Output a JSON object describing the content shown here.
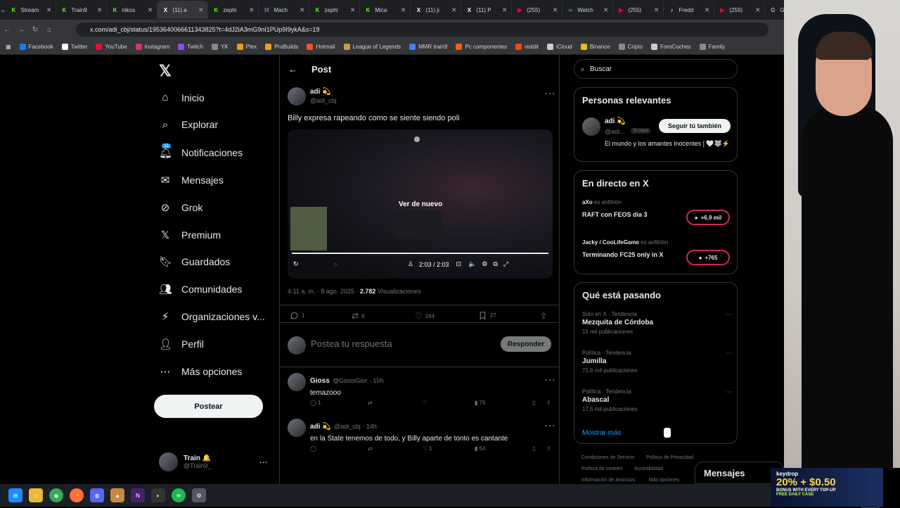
{
  "browser": {
    "tabs": [
      {
        "label": "Stream",
        "fav": "K",
        "color": "#53fc18"
      },
      {
        "label": "Train9",
        "fav": "K",
        "color": "#53fc18"
      },
      {
        "label": "nikos",
        "fav": "K",
        "color": "#53fc18"
      },
      {
        "label": "(11) a",
        "fav": "X",
        "color": "#ffffff",
        "active": true
      },
      {
        "label": "zephi",
        "fav": "K",
        "color": "#53fc18"
      },
      {
        "label": "Mach",
        "fav": "M",
        "color": "#9b59b6"
      },
      {
        "label": "zephi",
        "fav": "K",
        "color": "#53fc18"
      },
      {
        "label": "Mica",
        "fav": "K",
        "color": "#53fc18"
      },
      {
        "label": "(11) ji",
        "fav": "X",
        "color": "#ffffff"
      },
      {
        "label": "(11) P",
        "fav": "X",
        "color": "#ffffff"
      },
      {
        "label": "(255)",
        "fav": "▶",
        "color": "#ff0033"
      },
      {
        "label": "Watch",
        "fav": "∞",
        "color": "#1d9bf0"
      },
      {
        "label": "(255)",
        "fav": "▶",
        "color": "#ff0033"
      },
      {
        "label": "Fredd",
        "fav": "♪",
        "color": "#ffffff"
      },
      {
        "label": "(255)",
        "fav": "▶",
        "color": "#ff0033"
      },
      {
        "label": "Givea",
        "fav": "G",
        "color": "#aaaaaa"
      }
    ],
    "url": "x.com/adi_cbj/status/1953640066611343825?t=4dJ2iA3mG9nI1PUp9I9ykA&s=19",
    "bookmarks": [
      {
        "label": "Facebook",
        "color": "#1877f2"
      },
      {
        "label": "Twitter",
        "color": "#ffffff"
      },
      {
        "label": "YouTube",
        "color": "#ff0033"
      },
      {
        "label": "Instagram",
        "color": "#e1306c"
      },
      {
        "label": "Twitch",
        "color": "#9146ff"
      },
      {
        "label": "YK",
        "color": "#8a8a8a"
      },
      {
        "label": "Plex",
        "color": "#e5a00d"
      },
      {
        "label": "ProBuilds",
        "color": "#f0a020"
      },
      {
        "label": "Hotmail",
        "color": "#f25022"
      },
      {
        "label": "League of Legends",
        "color": "#c89b3c"
      },
      {
        "label": "MMR train9",
        "color": "#3b82f6"
      },
      {
        "label": "Pc componentes",
        "color": "#ff6000"
      },
      {
        "label": "reddit",
        "color": "#ff4500"
      },
      {
        "label": "iCloud",
        "color": "#cccccc"
      },
      {
        "label": "Binance",
        "color": "#f0b90b"
      },
      {
        "label": "Cripto",
        "color": "#8a8a8a"
      },
      {
        "label": "ForoCoches",
        "color": "#cccccc"
      },
      {
        "label": "Family",
        "color": "#8a8a8a"
      }
    ]
  },
  "nav": {
    "items": [
      {
        "label": "Inicio",
        "icon": "home-icon"
      },
      {
        "label": "Explorar",
        "icon": "search-icon"
      },
      {
        "label": "Notificaciones",
        "icon": "bell-icon"
      },
      {
        "label": "Mensajes",
        "icon": "mail-icon"
      },
      {
        "label": "Grok",
        "icon": "grok-icon"
      },
      {
        "label": "Premium",
        "icon": "x-icon"
      },
      {
        "label": "Guardados",
        "icon": "bookmark-icon"
      },
      {
        "label": "Comunidades",
        "icon": "people-icon"
      },
      {
        "label": "Organizaciones v...",
        "icon": "bolt-icon"
      },
      {
        "label": "Perfil",
        "icon": "person-icon"
      },
      {
        "label": "Más opciones",
        "icon": "more-icon"
      }
    ],
    "notif_badge": "11",
    "post_label": "Postear",
    "me_name": "Train 🔔",
    "me_handle": "@Train9_"
  },
  "post": {
    "header": "Post",
    "author_name": "adi 💫",
    "author_handle": "@adi_cbj",
    "text": "Billy expresa rapeando como se siente siendo poli",
    "video_overlay": "Ver de nuevo",
    "video_time": "2:03 / 2:03",
    "video_progress": 1.0,
    "timestamp": "4:11 a. m. · 8 ago. 2025 · ",
    "views_count": "2.782",
    "views_label": " Visualizaciones",
    "metrics": {
      "replies": "1",
      "reposts": "9",
      "likes": "164",
      "bookmarks": "27"
    },
    "reply_placeholder": "Postea tu respuesta",
    "reply_button": "Responder"
  },
  "replies": [
    {
      "name": "Gioss",
      "handle": "@GiossGior · 15h",
      "text": "temazooo",
      "replies": "1",
      "views": "76"
    },
    {
      "name": "adi 💫",
      "handle": "@adi_cbj · 14h",
      "text": "en la State tenemos de todo, y Billy aparte de tonto es cantante",
      "replies": "",
      "likes": "1",
      "views": "64"
    }
  ],
  "right": {
    "search_placeholder": "Buscar",
    "relevant_title": "Personas relevantes",
    "relevant_name": "adi 💫",
    "relevant_handle": "@adi...",
    "follows_you": "Te sigue",
    "follow_back": "Seguir tú también",
    "relevant_bio": "El mundo y los amantes inocentes | 🤍🐺⚡",
    "live_title": "En directo en X",
    "live": [
      {
        "host": "aXo",
        "host_label": "es anfitrión",
        "title": "RAFT con FEOS dia 3",
        "count": "+6,9 mil"
      },
      {
        "host": "Jacky / CooLifeGame",
        "host_label": "es anfitrión",
        "title": "Terminando FC25 only in X",
        "count": "+765"
      }
    ],
    "trends_title": "Qué está pasando",
    "trends": [
      {
        "cat": "Solo en X · Tendencia",
        "title": "Mezquita de Córdoba",
        "count": "15 mil publicaciones"
      },
      {
        "cat": "Política · Tendencia",
        "title": "Jumilla",
        "count": "71,6 mil publicaciones"
      },
      {
        "cat": "Política · Tendencia",
        "title": "Abascal",
        "count": "17,5 mil publicaciones"
      }
    ],
    "show_more": "Mostrar más",
    "footer": [
      "Condiciones de Servicio",
      "Política de Privacidad",
      "Política de cookies",
      "Accesibilidad",
      "Información de anuncios",
      "Más opciones"
    ],
    "messages_bar": "Mensajes"
  },
  "ad": {
    "brand": "keydrop",
    "headline": "20% + $0.50",
    "sub": "BONUS WITH EVERY TOP-UP",
    "foot": "FREE DAILY CASE"
  },
  "accent": "#1d9bf0"
}
